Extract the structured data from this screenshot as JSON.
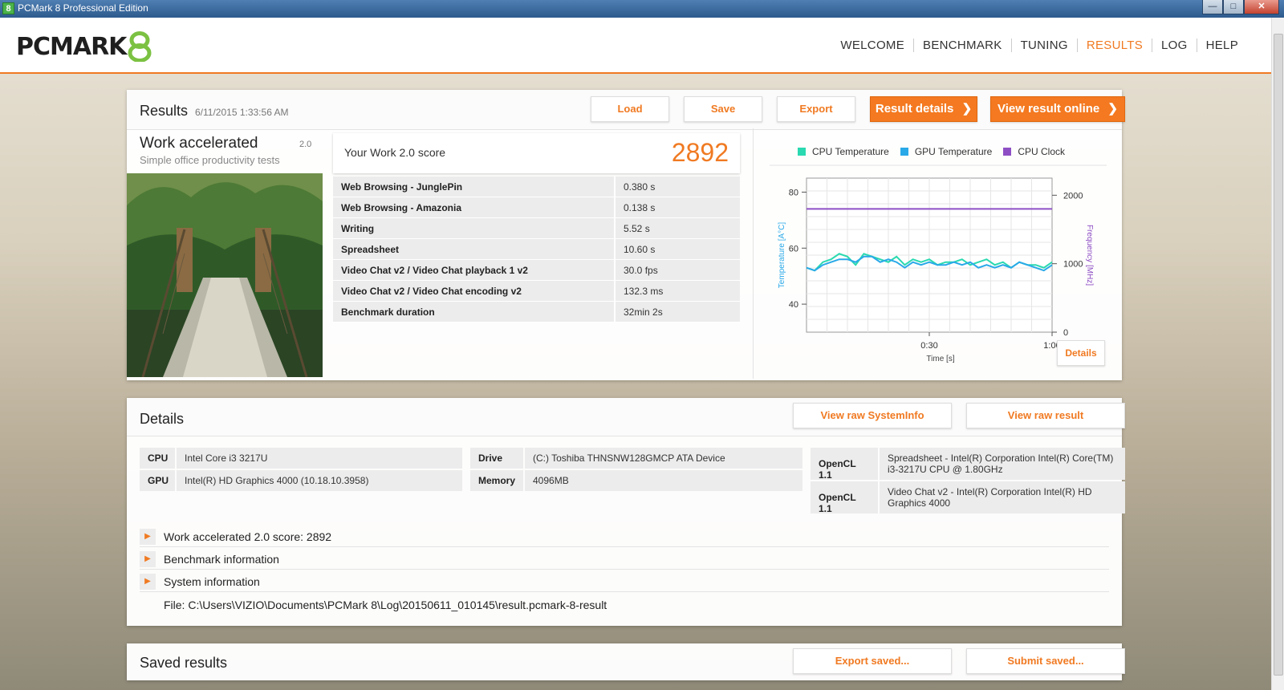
{
  "window": {
    "title": "PCMark 8 Professional Edition",
    "icon_glyph": "8"
  },
  "logo": {
    "text": "PCMARK",
    "number": "8",
    "color": "#7bc142"
  },
  "nav": [
    {
      "label": "WELCOME",
      "active": false
    },
    {
      "label": "BENCHMARK",
      "active": false
    },
    {
      "label": "TUNING",
      "active": false
    },
    {
      "label": "RESULTS",
      "active": true
    },
    {
      "label": "LOG",
      "active": false
    },
    {
      "label": "HELP",
      "active": false
    }
  ],
  "accent_color": "#f07a22",
  "results": {
    "title": "Results",
    "date": "6/11/2015 1:33:56 AM",
    "buttons": {
      "load": "Load",
      "save": "Save",
      "export": "Export",
      "result_details": "Result details",
      "view_online": "View result online"
    },
    "test": {
      "name": "Work accelerated",
      "version": "2.0",
      "description": "Simple office productivity tests"
    },
    "score": {
      "label": "Your Work 2.0 score",
      "value": "2892"
    },
    "rows": [
      {
        "name": "Web Browsing - JunglePin",
        "value": "0.380 s"
      },
      {
        "name": "Web Browsing - Amazonia",
        "value": "0.138 s"
      },
      {
        "name": "Writing",
        "value": "5.52 s"
      },
      {
        "name": "Spreadsheet",
        "value": "10.60 s"
      },
      {
        "name": "Video Chat v2 / Video Chat playback 1 v2",
        "value": "30.0 fps"
      },
      {
        "name": "Video Chat v2 / Video Chat encoding v2",
        "value": "132.3 ms"
      },
      {
        "name": "Benchmark duration",
        "value": "32min 2s"
      }
    ],
    "chart_details_button": "Details"
  },
  "chart_data": {
    "type": "line",
    "legend": [
      {
        "name": "CPU Temperature",
        "color": "#2ad9b0"
      },
      {
        "name": "GPU Temperature",
        "color": "#29a9e8"
      },
      {
        "name": "CPU Clock",
        "color": "#8e4fc4"
      }
    ],
    "xlabel": "Time [s]",
    "ylabel_left": "Temperature [A°C]",
    "ylabel_right": "Frequency [MHz]",
    "x_ticks": [
      {
        "value": 30,
        "label": "0:30"
      },
      {
        "value": 60,
        "label": "1:00"
      }
    ],
    "y_left_ticks": [
      40,
      60,
      80
    ],
    "y_right_ticks": [
      0,
      1000,
      2000
    ],
    "xlim": [
      0,
      60
    ],
    "ylim_left": [
      30,
      85
    ],
    "ylim_right": [
      0,
      2250
    ],
    "series": [
      {
        "name": "CPU Temperature",
        "axis": "left",
        "color": "#2ad9b0",
        "x": [
          0,
          2,
          4,
          6,
          8,
          10,
          12,
          14,
          16,
          18,
          20,
          22,
          24,
          26,
          28,
          30,
          32,
          34,
          36,
          38,
          40,
          42,
          44,
          46,
          48,
          50,
          52,
          54,
          56,
          58,
          60
        ],
        "y": [
          53,
          52,
          55,
          56,
          58,
          57,
          54,
          58,
          57,
          56,
          55,
          57,
          54,
          56,
          55,
          56,
          54,
          55,
          55,
          56,
          54,
          55,
          56,
          54,
          55,
          53,
          55,
          54,
          54,
          53,
          55
        ]
      },
      {
        "name": "GPU Temperature",
        "axis": "left",
        "color": "#29a9e8",
        "x": [
          0,
          2,
          4,
          6,
          8,
          10,
          12,
          14,
          16,
          18,
          20,
          22,
          24,
          26,
          28,
          30,
          32,
          34,
          36,
          38,
          40,
          42,
          44,
          46,
          48,
          50,
          52,
          54,
          56,
          58,
          60
        ],
        "y": [
          53,
          52,
          54,
          55,
          56,
          56,
          55,
          57,
          57,
          55,
          56,
          55,
          53,
          55,
          54,
          55,
          54,
          54,
          55,
          54,
          55,
          53,
          54,
          53,
          54,
          53,
          55,
          54,
          53,
          52,
          54
        ]
      },
      {
        "name": "CPU Clock",
        "axis": "right",
        "color": "#8e4fc4",
        "x": [
          0,
          60
        ],
        "y": [
          1800,
          1800
        ]
      }
    ]
  },
  "details": {
    "title": "Details",
    "buttons": {
      "raw_sysinfo": "View raw SystemInfo",
      "raw_result": "View raw result"
    },
    "cpu": {
      "key": "CPU",
      "value": "Intel Core i3 3217U"
    },
    "gpu": {
      "key": "GPU",
      "value": "Intel(R) HD Graphics 4000 (10.18.10.3958)"
    },
    "drive": {
      "key": "Drive",
      "value": "(C:) Toshiba THNSNW128GMCP ATA Device"
    },
    "memory": {
      "key": "Memory",
      "value": "4096MB"
    },
    "opencl1": {
      "key": "OpenCL 1.1",
      "line1": "Spreadsheet - Intel(R) Corporation Intel(R) Core(TM)",
      "line2": "i3-3217U CPU @ 1.80GHz"
    },
    "opencl2": {
      "key": "OpenCL 1.1",
      "line1": "Video Chat v2 - Intel(R) Corporation Intel(R) HD",
      "line2": "Graphics 4000"
    },
    "expanders": [
      "Work accelerated 2.0 score: 2892",
      "Benchmark information",
      "System information"
    ],
    "file_path": "File: C:\\Users\\VIZIO\\Documents\\PCMark 8\\Log\\20150611_010145\\result.pcmark-8-result"
  },
  "saved": {
    "title": "Saved results",
    "buttons": {
      "export_saved": "Export saved...",
      "submit_saved": "Submit saved..."
    }
  }
}
